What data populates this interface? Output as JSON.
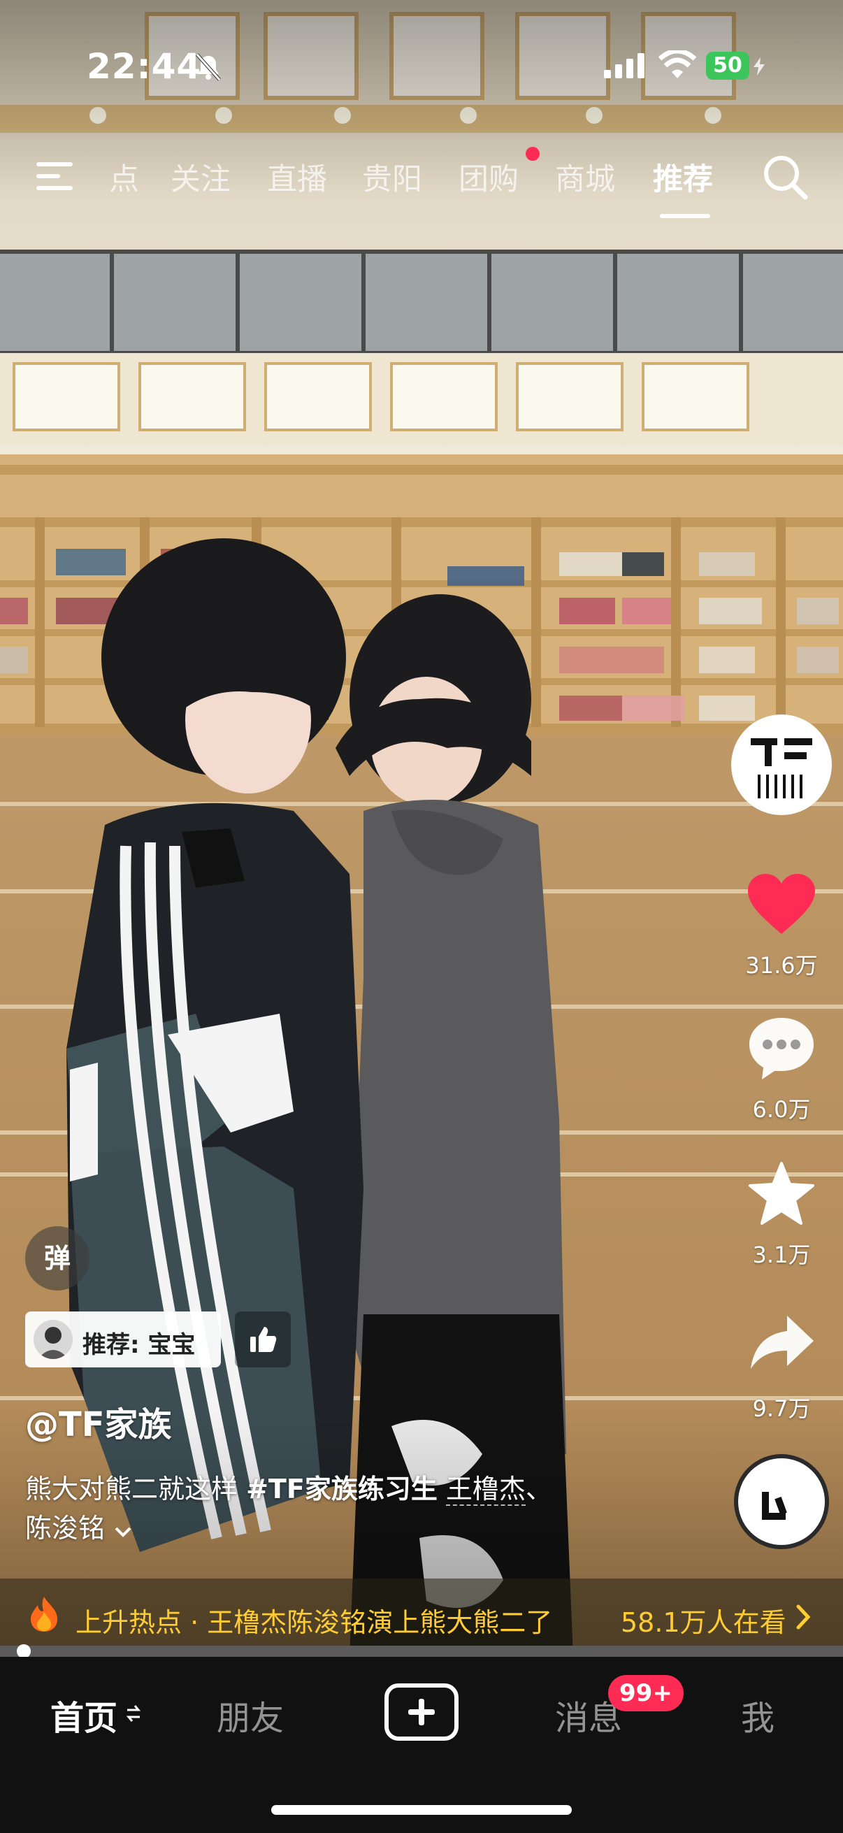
{
  "status_bar": {
    "time": "22:44",
    "battery": "50"
  },
  "top_nav": {
    "tabs": [
      {
        "label": "点"
      },
      {
        "label": "关注"
      },
      {
        "label": "直播"
      },
      {
        "label": "贵阳"
      },
      {
        "label": "团购"
      },
      {
        "label": "商城"
      },
      {
        "label": "推荐",
        "active": true
      }
    ]
  },
  "side": {
    "likes": "31.6万",
    "comments": "6.0万",
    "favorites": "3.1万",
    "shares": "9.7万"
  },
  "danmaku_label": "弹",
  "recommend": {
    "text": "推荐: 宝宝"
  },
  "author": "@TF家族",
  "caption": {
    "line1_a": "熊大对熊二就这样 ",
    "hashtag": "#TF家族练习生",
    "mention1": "王橹杰",
    "sep": "、",
    "mention2": "陈浚铭"
  },
  "hot_bar": {
    "text": "上升热点 · 王橹杰陈浚铭演上熊大熊二了",
    "watching": "58.1万人在看"
  },
  "bottom_nav": {
    "home": "首页",
    "friends": "朋友",
    "messages": "消息",
    "badge": "99+",
    "me": "我"
  },
  "colors": {
    "accent_red": "#fe2c55",
    "hot_yellow": "#ffcc33",
    "battery_green": "#3bc55a"
  }
}
